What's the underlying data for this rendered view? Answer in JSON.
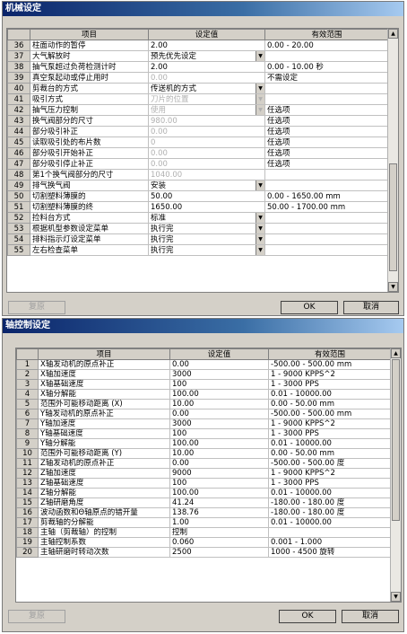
{
  "mech": {
    "title": "机械设定",
    "headers": [
      "项目",
      "设定值",
      "有效范围"
    ],
    "rows": [
      {
        "n": "36",
        "item": "柱面动作的暂停",
        "val": "2.00",
        "range": "0.00 - 20.00",
        "dd": false,
        "dis": false
      },
      {
        "n": "37",
        "item": "大气解放时",
        "val": "预先优先设定",
        "range": "",
        "dd": true,
        "dis": false
      },
      {
        "n": "38",
        "item": "抽气泵超过负荷检测计时",
        "val": "2.00",
        "range": "0.00 - 10.00 秒",
        "dd": false,
        "dis": false
      },
      {
        "n": "39",
        "item": "真空泵起动或停止用时",
        "val": "0.00",
        "range": "不需设定",
        "dd": false,
        "dis": true
      },
      {
        "n": "40",
        "item": "剪裁台的方式",
        "val": "传送机的方式",
        "range": "",
        "dd": true,
        "dis": false
      },
      {
        "n": "41",
        "item": "吸引方式",
        "val": "刀片的位置",
        "range": "",
        "dd": true,
        "dis": true
      },
      {
        "n": "42",
        "item": "抽气压力控制",
        "val": "使用",
        "range": "任选项",
        "dd": true,
        "dis": true
      },
      {
        "n": "43",
        "item": "换气阀部分的尺寸",
        "val": "980.00",
        "range": "任选项",
        "dd": false,
        "dis": true
      },
      {
        "n": "44",
        "item": "部分吸引补正",
        "val": "0.00",
        "range": "任选项",
        "dd": false,
        "dis": true
      },
      {
        "n": "45",
        "item": "读取吸引处的布片数",
        "val": "0",
        "range": "任选项",
        "dd": false,
        "dis": true
      },
      {
        "n": "46",
        "item": "部分吸引开始补正",
        "val": "0.00",
        "range": "任选项",
        "dd": false,
        "dis": true
      },
      {
        "n": "47",
        "item": "部分吸引停止补正",
        "val": "0.00",
        "range": "任选项",
        "dd": false,
        "dis": true
      },
      {
        "n": "48",
        "item": "第1个换气阀部分的尺寸",
        "val": "1040.00",
        "range": "",
        "dd": false,
        "dis": true
      },
      {
        "n": "49",
        "item": "排气换气阀",
        "val": "安装",
        "range": "",
        "dd": true,
        "dis": false
      },
      {
        "n": "50",
        "item": "切割塑料薄膜的",
        "val": "50.00",
        "range": "0.00 - 1650.00 mm",
        "dd": false,
        "dis": false
      },
      {
        "n": "51",
        "item": "切割塑料薄膜的终",
        "val": "1650.00",
        "range": "50.00 - 1700.00 mm",
        "dd": false,
        "dis": false
      },
      {
        "n": "52",
        "item": "捡料台方式",
        "val": "标准",
        "range": "",
        "dd": true,
        "dis": false
      },
      {
        "n": "53",
        "item": "根据机型参数设定菜单",
        "val": "执行完",
        "range": "",
        "dd": true,
        "dis": false
      },
      {
        "n": "54",
        "item": "排料指示灯设定菜单",
        "val": "执行完",
        "range": "",
        "dd": true,
        "dis": false
      },
      {
        "n": "55",
        "item": "左右检查菜单",
        "val": "执行完",
        "range": "",
        "dd": true,
        "dis": false
      }
    ],
    "btn_restore": "复原",
    "btn_ok": "OK",
    "btn_cancel": "取消",
    "arrow_up": "▲",
    "arrow_down": "▼"
  },
  "axis": {
    "title": "轴控制设定",
    "headers": [
      "项目",
      "设定值",
      "有效范围"
    ],
    "rows": [
      {
        "n": "1",
        "item": "X轴发动机的原点补正",
        "val": "0.00",
        "range": "-500.00 -   500.00 mm"
      },
      {
        "n": "2",
        "item": "X轴加速度",
        "val": "3000",
        "range": "1  -   9000 KPPS^2"
      },
      {
        "n": "3",
        "item": "X轴基础速度",
        "val": "100",
        "range": "1  -   3000 PPS"
      },
      {
        "n": "4",
        "item": "X轴分解能",
        "val": "100.00",
        "range": "0.01 - 10000.00"
      },
      {
        "n": "5",
        "item": "范围外可能移动距离 (X)",
        "val": "10.00",
        "range": "0.00 -    50.00 mm"
      },
      {
        "n": "6",
        "item": "Y轴发动机的原点补正",
        "val": "0.00",
        "range": "-500.00 -   500.00 mm"
      },
      {
        "n": "7",
        "item": "Y轴加速度",
        "val": "3000",
        "range": "1  -   9000 KPPS^2"
      },
      {
        "n": "8",
        "item": "Y轴基础速度",
        "val": "100",
        "range": "1  -   3000 PPS"
      },
      {
        "n": "9",
        "item": "Y轴分解能",
        "val": "100.00",
        "range": "0.01 - 10000.00"
      },
      {
        "n": "10",
        "item": "范围外可能移动距离 (Y)",
        "val": "10.00",
        "range": "0.00 -    50.00 mm"
      },
      {
        "n": "11",
        "item": "Z轴发动机的原点补正",
        "val": "0.00",
        "range": "-500.00 -   500.00 度"
      },
      {
        "n": "12",
        "item": "Z轴加速度",
        "val": "9000",
        "range": "1  -   9000 KPPS^2"
      },
      {
        "n": "13",
        "item": "Z轴基础速度",
        "val": "100",
        "range": "1  -   3000 PPS"
      },
      {
        "n": "14",
        "item": "Z轴分解能",
        "val": "100.00",
        "range": "0.01 - 10000.00"
      },
      {
        "n": "15",
        "item": "Z轴研磨角度",
        "val": "41.24",
        "range": "-180.00 -   180.00 度"
      },
      {
        "n": "16",
        "item": "波动函数和Θ轴原点的错开量",
        "val": "138.76",
        "range": "-180.00 -   180.00 度"
      },
      {
        "n": "17",
        "item": "剪裁轴的分解能",
        "val": "1.00",
        "range": "0.01 - 10000.00"
      },
      {
        "n": "18",
        "item": "主轴（剪裁轴）的控制",
        "val": "控制",
        "range": ""
      },
      {
        "n": "19",
        "item": "主轴控制系数",
        "val": "0.060",
        "range": "0.001 - 1.000"
      },
      {
        "n": "20",
        "item": "主轴研磨时转动次数",
        "val": "2500",
        "range": "1000 - 4500 旋转"
      }
    ],
    "btn_restore": "复原",
    "btn_ok": "OK",
    "btn_cancel": "取消",
    "arrow_up": "▲",
    "arrow_down": "▼"
  }
}
